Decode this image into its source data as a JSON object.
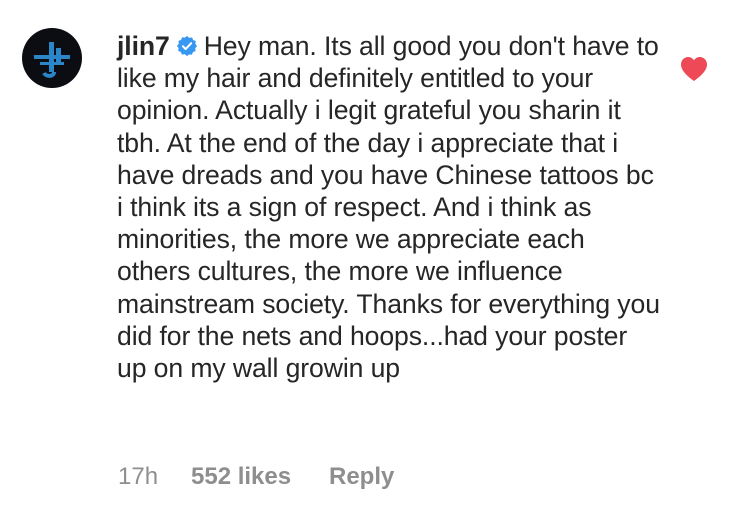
{
  "comment": {
    "username": "jlin7",
    "text": "Hey man. Its all good you don't have to like my hair and definitely entitled to your opinion. Actually i legit grateful you sharin it tbh. At the end of the day i appreciate that i have dreads and you have Chinese tattoos bc i think its a sign of respect. And i think as minorities, the more we appreciate each others cultures, the more we influence mainstream society. Thanks for everything you did for the nets and hoops...had your poster up on my wall growin up",
    "verified_icon": "verified-badge-icon",
    "avatar_icon": "jl-logo-icon",
    "liked": true,
    "heart_color": "#ed4956",
    "verified_color": "#3897f0",
    "avatar_bg": "#0b0d12",
    "logo_color": "#2a86c8"
  },
  "meta": {
    "time": "17h",
    "likes": "552 likes",
    "reply": "Reply"
  }
}
